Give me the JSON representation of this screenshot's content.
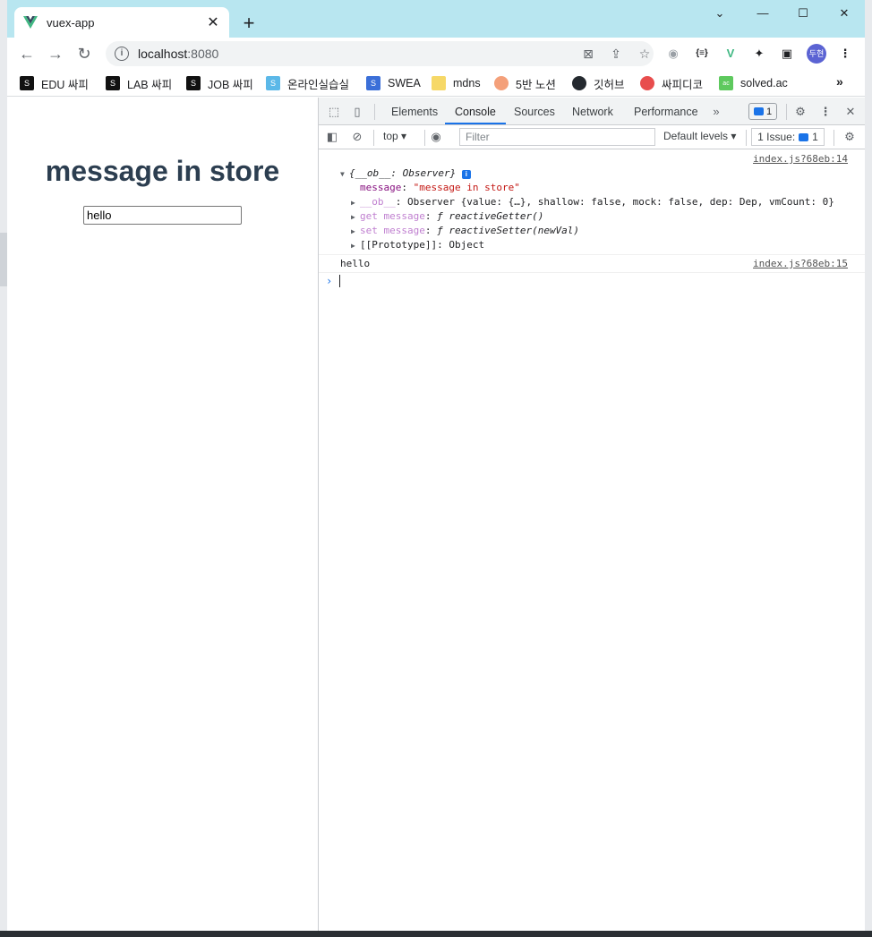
{
  "browser": {
    "tab_title": "vuex-app",
    "tab_close": "✕",
    "new_tab": "+",
    "window_buttons": {
      "minimize": "⌄",
      "min": "—",
      "max": "☐",
      "close": "✕"
    },
    "url_host": "localhost",
    "url_port": ":8080",
    "profile_initials": "두현"
  },
  "bookmarks": [
    {
      "label": "EDU 싸피",
      "icon": "ssafy-icon",
      "color": "#111111"
    },
    {
      "label": "LAB 싸피",
      "icon": "ssafy-icon",
      "color": "#111111"
    },
    {
      "label": "JOB 싸피",
      "icon": "ssafy-icon",
      "color": "#111111"
    },
    {
      "label": "온라인실습실",
      "icon": "ssafy-lab-icon",
      "color": "#5bb8e8"
    },
    {
      "label": "SWEA",
      "icon": "swea-icon",
      "color": "#3b6fd8"
    },
    {
      "label": "mdns",
      "icon": "folder-icon",
      "color": "#f6d867"
    },
    {
      "label": "5반 노션",
      "icon": "peach-icon",
      "color": "#f4a07a"
    },
    {
      "label": "깃허브",
      "icon": "github-icon",
      "color": "#24292f"
    },
    {
      "label": "싸피디코",
      "icon": "discord-icon",
      "color": "#e84d4d"
    },
    {
      "label": "solved.ac",
      "icon": "solvedac-icon",
      "color": "#5ec95e"
    }
  ],
  "bookmarks_more": "»",
  "page": {
    "heading": "message in store",
    "input_value": "hello"
  },
  "devtools": {
    "tabs": [
      "Elements",
      "Console",
      "Sources",
      "Network",
      "Performance"
    ],
    "active_tab": "Console",
    "more_tabs": "»",
    "message_count": "1",
    "context": "top ▾",
    "filter_placeholder": "Filter",
    "levels": "Default levels ▾",
    "issues_label": "1 Issue:",
    "issues_count": "1"
  },
  "console": {
    "entry1_source": "index.js?68eb:14",
    "entry1_header": "{__ob__: Observer}",
    "entry1_lines": {
      "message_key": "message",
      "message_val": "\"message in store\"",
      "ob_key": "__ob__",
      "ob_val": "Observer {value: {…}, shallow: false, mock: false, dep: Dep, vmCount: 0}",
      "get_key": "get message",
      "get_val": "ƒ reactiveGetter()",
      "set_key": "set message",
      "set_val": "ƒ reactiveSetter(newVal)",
      "proto_key": "[[Prototype]]",
      "proto_val": "Object"
    },
    "entry2_text": "hello",
    "entry2_source": "index.js?68eb:15"
  },
  "colors": {
    "tabstrip": "#b8e6f0",
    "heading": "#2c3e50",
    "accent": "#1a73e8"
  }
}
